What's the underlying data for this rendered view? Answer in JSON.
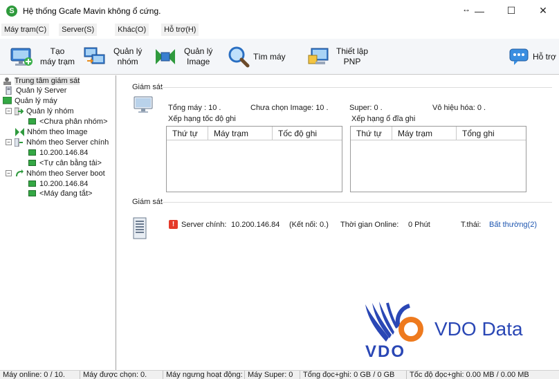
{
  "window": {
    "title": "Hệ thống  Gcafe Mavin không ổ cứng.",
    "app_icon_glyph": "S",
    "restore_glyph": "↔",
    "minimize_glyph": "—",
    "maximize_glyph": "☐",
    "close_glyph": "✕"
  },
  "menu": {
    "items": [
      "Máy trạm(C)",
      "Server(S)",
      "Khác(O)",
      "Hỗ trợ(H)"
    ]
  },
  "toolbar": {
    "create_station": {
      "line1": "Tạo",
      "line2": "máy trạm"
    },
    "manage_group": {
      "line1": "Quản lý",
      "line2": "nhóm"
    },
    "manage_image": {
      "line1": "Quản lý",
      "line2": "Image"
    },
    "find_machine": {
      "label": "Tìm máy"
    },
    "setup_pnp": {
      "line1": "Thiết lập",
      "line2": "PNP"
    },
    "support": {
      "label": "Hỗ trợ"
    }
  },
  "tree": {
    "items": [
      {
        "label": "Trung tâm giám sát"
      },
      {
        "label": "Quản lý Server"
      },
      {
        "label": "Quản lý máy"
      },
      {
        "label": "Quản lý nhóm"
      },
      {
        "label": "<Chưa phân nhóm>"
      },
      {
        "label": "Nhóm theo Image"
      },
      {
        "label": "Nhóm theo Server chính"
      },
      {
        "label": "10.200.146.84"
      },
      {
        "label": "<Tự cân bằng tải>"
      },
      {
        "label": "Nhóm theo Server boot"
      },
      {
        "label": "10.200.146.84"
      },
      {
        "label": "<Máy đang tắt>"
      }
    ],
    "expander_glyph": "−"
  },
  "monitor1": {
    "title": "Giám sát",
    "total_machines": "Tổng máy :  10 .",
    "no_image": "Chưa chọn Image:  10 .",
    "super": "Super:           0 .",
    "disabled": "Vô hiệu hóa:  0 ."
  },
  "speed_rank": {
    "title": "Xếp hạng tốc độ ghi",
    "columns": [
      "Thứ tự",
      "Máy trạm",
      "Tốc độ ghi"
    ]
  },
  "disk_rank": {
    "title": "Xếp hạng ổ đĩa ghi",
    "columns": [
      "Thứ tự",
      "Máy trạm",
      "Tổng ghi"
    ]
  },
  "monitor2": {
    "title": "Giám sát",
    "alert_glyph": "!",
    "server_label": "Server chính:",
    "server_ip": "10.200.146.84",
    "connections": "(Kết nối: 0.)",
    "online_label": "Thời gian Online:",
    "online_value": "0 Phút",
    "status_label": "T.thái:",
    "status_value": "Bất thường(2)"
  },
  "logo": {
    "mark_text": "VDO",
    "brand": "VDO Data",
    "blue": "#2a47b5",
    "orange": "#ee7a1e"
  },
  "statusbar": {
    "items": [
      "Máy online: 0 / 10.",
      "Máy được chọn: 0.",
      "Máy ngưng hoạt động:",
      "Máy Super: 0",
      "Tổng đọc+ghi: 0 GB / 0 GB",
      "Tốc độ đọc+ghi: 0.00 MB / 0.00 MB"
    ]
  }
}
